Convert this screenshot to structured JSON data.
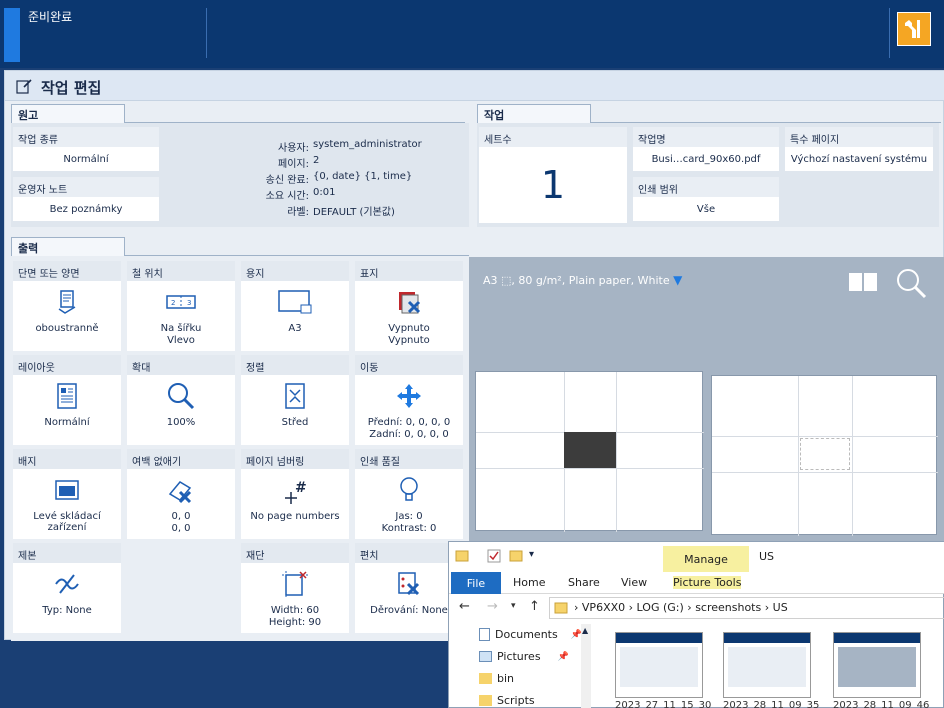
{
  "status": {
    "text": "준비완료"
  },
  "page_title": "작업 편집",
  "original": {
    "tab": "원고",
    "job_type_label": "작업 종류",
    "job_type_value": "Normální",
    "operator_note_label": "운영자 노트",
    "operator_note_value": "Bez poznámky",
    "info": [
      {
        "k": "사용자:",
        "v": "system_administrator"
      },
      {
        "k": "페이지:",
        "v": "2"
      },
      {
        "k": "송신 완료:",
        "v": "{0, date} {1, time}"
      },
      {
        "k": "소요 시간:",
        "v": "0:01"
      },
      {
        "k": "라벨:",
        "v": "DEFAULT (기본값)"
      }
    ]
  },
  "job": {
    "tab": "작업",
    "copies_label": "세트수",
    "copies_value": "1",
    "name_label": "작업명",
    "name_value": "Busi…card_90x60.pdf",
    "special_label": "특수 페이지",
    "special_value": "Výchozí nastavení systému",
    "range_label": "인쇄 범위",
    "range_value": "Vše"
  },
  "output": {
    "tab": "출력",
    "tiles": [
      {
        "h": "단면 또는 양면",
        "t1": "oboustranně",
        "t2": ""
      },
      {
        "h": "철 위치",
        "t1": "Na šířku",
        "t2": "Vlevo"
      },
      {
        "h": "용지",
        "t1": "A3",
        "t2": ""
      },
      {
        "h": "표지",
        "t1": "Vypnuto",
        "t2": "Vypnuto"
      },
      {
        "h": "레이아웃",
        "t1": "Normální",
        "t2": ""
      },
      {
        "h": "확대",
        "t1": "100%",
        "t2": ""
      },
      {
        "h": "정렬",
        "t1": "Střed",
        "t2": ""
      },
      {
        "h": "이동",
        "t1": "Přední: 0, 0, 0, 0",
        "t2": "Zadní: 0, 0, 0, 0"
      },
      {
        "h": "배지",
        "t1": "Levé skládací zařízení",
        "t2": ""
      },
      {
        "h": "여백 없애기",
        "t1": "0, 0",
        "t2": "0, 0"
      },
      {
        "h": "페이지 넘버링",
        "t1": "No page numbers",
        "t2": ""
      },
      {
        "h": "인쇄 품질",
        "t1": "Jas: 0",
        "t2": "Kontrast: 0"
      },
      {
        "h": "제본",
        "t1": "Typ: None",
        "t2": ""
      },
      {
        "h": "재단",
        "t1": "Width: 60",
        "t2": "Height: 90"
      },
      {
        "h": "편치",
        "t1": "Děrování: None",
        "t2": ""
      }
    ]
  },
  "preview": {
    "paper": "A3 ⬚, 80 g/m², Plain paper, White"
  },
  "explorer": {
    "window_title": "US",
    "manage": "Manage",
    "picture_tools": "Picture Tools",
    "ribbon": [
      "File",
      "Home",
      "Share",
      "View"
    ],
    "breadcrumb": [
      "VP6XX0",
      "LOG (G:)",
      "screenshots",
      "US"
    ],
    "nav": [
      "Documents",
      "Pictures",
      "bin",
      "Scripts"
    ],
    "thumbs": [
      "2023_27_11_15_30",
      "2023_28_11_09_35",
      "2023_28_11_09_46"
    ]
  },
  "colors": {
    "topbar": "#0b3770",
    "accent": "#1f7ae0",
    "tools": "#f5a623",
    "icon": "#1f5fb4"
  }
}
